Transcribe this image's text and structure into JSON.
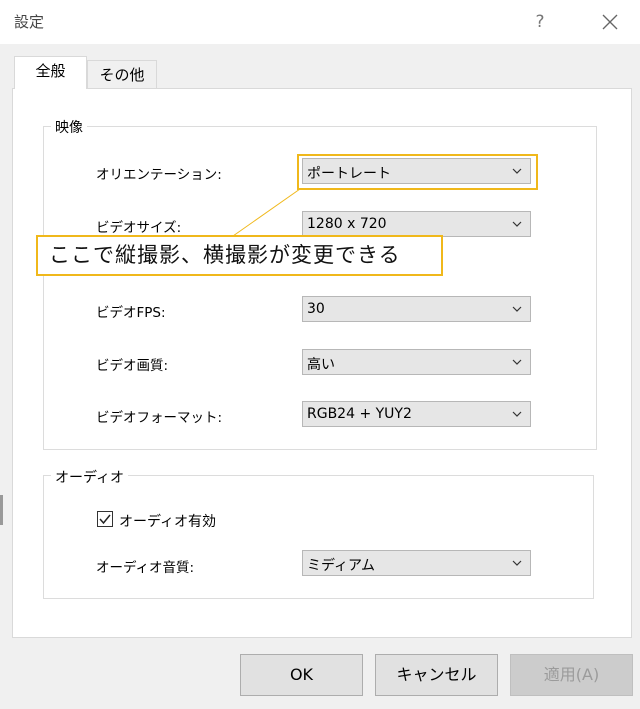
{
  "window": {
    "title": "設定",
    "help_label": "?",
    "close_icon": "close-icon"
  },
  "tabs": [
    {
      "label": "全般",
      "active": true
    },
    {
      "label": "その他",
      "active": false
    }
  ],
  "video": {
    "title": "映像",
    "fields": [
      {
        "label": "オリエンテーション:",
        "value": "ポートレート"
      },
      {
        "label": "ビデオサイズ:",
        "value": "1280 x 720"
      },
      {
        "label": "ビデオFPS:",
        "value": "30"
      },
      {
        "label": "ビデオ画質:",
        "value": "高い"
      },
      {
        "label": "ビデオフォーマット:",
        "value": "RGB24 + YUY2"
      }
    ]
  },
  "callout": {
    "text": "ここで縦撮影、横撮影が変更できる",
    "color": "#f0b81b"
  },
  "audio": {
    "title": "オーディオ",
    "enable_label": "オーディオ有効",
    "enable_checked": true,
    "quality_label": "オーディオ音質:",
    "quality_value": "ミディアム"
  },
  "buttons": {
    "ok": "OK",
    "cancel": "キャンセル",
    "apply": "適用(A)"
  }
}
